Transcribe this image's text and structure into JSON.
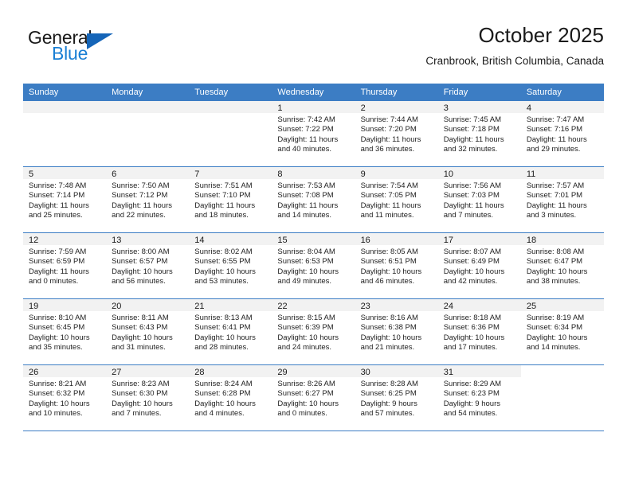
{
  "brand": {
    "name_part1": "General",
    "name_part2": "Blue",
    "triangle_icon": "brand-triangle-icon",
    "accent_color": "#1a7fd4"
  },
  "header": {
    "title": "October 2025",
    "subtitle": "Cranbrook, British Columbia, Canada"
  },
  "theme": {
    "header_bg": "#3c7dc4",
    "daynum_bg": "#f2f2f2",
    "grid_line": "#3c7dc4"
  },
  "weekday_headers": [
    "Sunday",
    "Monday",
    "Tuesday",
    "Wednesday",
    "Thursday",
    "Friday",
    "Saturday"
  ],
  "weeks": [
    [
      {
        "day": "",
        "sunrise": "",
        "sunset": "",
        "daylight_line1": "",
        "daylight_line2": "",
        "empty": true
      },
      {
        "day": "",
        "sunrise": "",
        "sunset": "",
        "daylight_line1": "",
        "daylight_line2": "",
        "empty": true
      },
      {
        "day": "",
        "sunrise": "",
        "sunset": "",
        "daylight_line1": "",
        "daylight_line2": "",
        "empty": true
      },
      {
        "day": "1",
        "sunrise": "Sunrise: 7:42 AM",
        "sunset": "Sunset: 7:22 PM",
        "daylight_line1": "Daylight: 11 hours",
        "daylight_line2": "and 40 minutes."
      },
      {
        "day": "2",
        "sunrise": "Sunrise: 7:44 AM",
        "sunset": "Sunset: 7:20 PM",
        "daylight_line1": "Daylight: 11 hours",
        "daylight_line2": "and 36 minutes."
      },
      {
        "day": "3",
        "sunrise": "Sunrise: 7:45 AM",
        "sunset": "Sunset: 7:18 PM",
        "daylight_line1": "Daylight: 11 hours",
        "daylight_line2": "and 32 minutes."
      },
      {
        "day": "4",
        "sunrise": "Sunrise: 7:47 AM",
        "sunset": "Sunset: 7:16 PM",
        "daylight_line1": "Daylight: 11 hours",
        "daylight_line2": "and 29 minutes."
      }
    ],
    [
      {
        "day": "5",
        "sunrise": "Sunrise: 7:48 AM",
        "sunset": "Sunset: 7:14 PM",
        "daylight_line1": "Daylight: 11 hours",
        "daylight_line2": "and 25 minutes."
      },
      {
        "day": "6",
        "sunrise": "Sunrise: 7:50 AM",
        "sunset": "Sunset: 7:12 PM",
        "daylight_line1": "Daylight: 11 hours",
        "daylight_line2": "and 22 minutes."
      },
      {
        "day": "7",
        "sunrise": "Sunrise: 7:51 AM",
        "sunset": "Sunset: 7:10 PM",
        "daylight_line1": "Daylight: 11 hours",
        "daylight_line2": "and 18 minutes."
      },
      {
        "day": "8",
        "sunrise": "Sunrise: 7:53 AM",
        "sunset": "Sunset: 7:08 PM",
        "daylight_line1": "Daylight: 11 hours",
        "daylight_line2": "and 14 minutes."
      },
      {
        "day": "9",
        "sunrise": "Sunrise: 7:54 AM",
        "sunset": "Sunset: 7:05 PM",
        "daylight_line1": "Daylight: 11 hours",
        "daylight_line2": "and 11 minutes."
      },
      {
        "day": "10",
        "sunrise": "Sunrise: 7:56 AM",
        "sunset": "Sunset: 7:03 PM",
        "daylight_line1": "Daylight: 11 hours",
        "daylight_line2": "and 7 minutes."
      },
      {
        "day": "11",
        "sunrise": "Sunrise: 7:57 AM",
        "sunset": "Sunset: 7:01 PM",
        "daylight_line1": "Daylight: 11 hours",
        "daylight_line2": "and 3 minutes."
      }
    ],
    [
      {
        "day": "12",
        "sunrise": "Sunrise: 7:59 AM",
        "sunset": "Sunset: 6:59 PM",
        "daylight_line1": "Daylight: 11 hours",
        "daylight_line2": "and 0 minutes."
      },
      {
        "day": "13",
        "sunrise": "Sunrise: 8:00 AM",
        "sunset": "Sunset: 6:57 PM",
        "daylight_line1": "Daylight: 10 hours",
        "daylight_line2": "and 56 minutes."
      },
      {
        "day": "14",
        "sunrise": "Sunrise: 8:02 AM",
        "sunset": "Sunset: 6:55 PM",
        "daylight_line1": "Daylight: 10 hours",
        "daylight_line2": "and 53 minutes."
      },
      {
        "day": "15",
        "sunrise": "Sunrise: 8:04 AM",
        "sunset": "Sunset: 6:53 PM",
        "daylight_line1": "Daylight: 10 hours",
        "daylight_line2": "and 49 minutes."
      },
      {
        "day": "16",
        "sunrise": "Sunrise: 8:05 AM",
        "sunset": "Sunset: 6:51 PM",
        "daylight_line1": "Daylight: 10 hours",
        "daylight_line2": "and 46 minutes."
      },
      {
        "day": "17",
        "sunrise": "Sunrise: 8:07 AM",
        "sunset": "Sunset: 6:49 PM",
        "daylight_line1": "Daylight: 10 hours",
        "daylight_line2": "and 42 minutes."
      },
      {
        "day": "18",
        "sunrise": "Sunrise: 8:08 AM",
        "sunset": "Sunset: 6:47 PM",
        "daylight_line1": "Daylight: 10 hours",
        "daylight_line2": "and 38 minutes."
      }
    ],
    [
      {
        "day": "19",
        "sunrise": "Sunrise: 8:10 AM",
        "sunset": "Sunset: 6:45 PM",
        "daylight_line1": "Daylight: 10 hours",
        "daylight_line2": "and 35 minutes."
      },
      {
        "day": "20",
        "sunrise": "Sunrise: 8:11 AM",
        "sunset": "Sunset: 6:43 PM",
        "daylight_line1": "Daylight: 10 hours",
        "daylight_line2": "and 31 minutes."
      },
      {
        "day": "21",
        "sunrise": "Sunrise: 8:13 AM",
        "sunset": "Sunset: 6:41 PM",
        "daylight_line1": "Daylight: 10 hours",
        "daylight_line2": "and 28 minutes."
      },
      {
        "day": "22",
        "sunrise": "Sunrise: 8:15 AM",
        "sunset": "Sunset: 6:39 PM",
        "daylight_line1": "Daylight: 10 hours",
        "daylight_line2": "and 24 minutes."
      },
      {
        "day": "23",
        "sunrise": "Sunrise: 8:16 AM",
        "sunset": "Sunset: 6:38 PM",
        "daylight_line1": "Daylight: 10 hours",
        "daylight_line2": "and 21 minutes."
      },
      {
        "day": "24",
        "sunrise": "Sunrise: 8:18 AM",
        "sunset": "Sunset: 6:36 PM",
        "daylight_line1": "Daylight: 10 hours",
        "daylight_line2": "and 17 minutes."
      },
      {
        "day": "25",
        "sunrise": "Sunrise: 8:19 AM",
        "sunset": "Sunset: 6:34 PM",
        "daylight_line1": "Daylight: 10 hours",
        "daylight_line2": "and 14 minutes."
      }
    ],
    [
      {
        "day": "26",
        "sunrise": "Sunrise: 8:21 AM",
        "sunset": "Sunset: 6:32 PM",
        "daylight_line1": "Daylight: 10 hours",
        "daylight_line2": "and 10 minutes."
      },
      {
        "day": "27",
        "sunrise": "Sunrise: 8:23 AM",
        "sunset": "Sunset: 6:30 PM",
        "daylight_line1": "Daylight: 10 hours",
        "daylight_line2": "and 7 minutes."
      },
      {
        "day": "28",
        "sunrise": "Sunrise: 8:24 AM",
        "sunset": "Sunset: 6:28 PM",
        "daylight_line1": "Daylight: 10 hours",
        "daylight_line2": "and 4 minutes."
      },
      {
        "day": "29",
        "sunrise": "Sunrise: 8:26 AM",
        "sunset": "Sunset: 6:27 PM",
        "daylight_line1": "Daylight: 10 hours",
        "daylight_line2": "and 0 minutes."
      },
      {
        "day": "30",
        "sunrise": "Sunrise: 8:28 AM",
        "sunset": "Sunset: 6:25 PM",
        "daylight_line1": "Daylight: 9 hours",
        "daylight_line2": "and 57 minutes."
      },
      {
        "day": "31",
        "sunrise": "Sunrise: 8:29 AM",
        "sunset": "Sunset: 6:23 PM",
        "daylight_line1": "Daylight: 9 hours",
        "daylight_line2": "and 54 minutes."
      },
      {
        "day": "",
        "sunrise": "",
        "sunset": "",
        "daylight_line1": "",
        "daylight_line2": "",
        "blank": true
      }
    ]
  ]
}
